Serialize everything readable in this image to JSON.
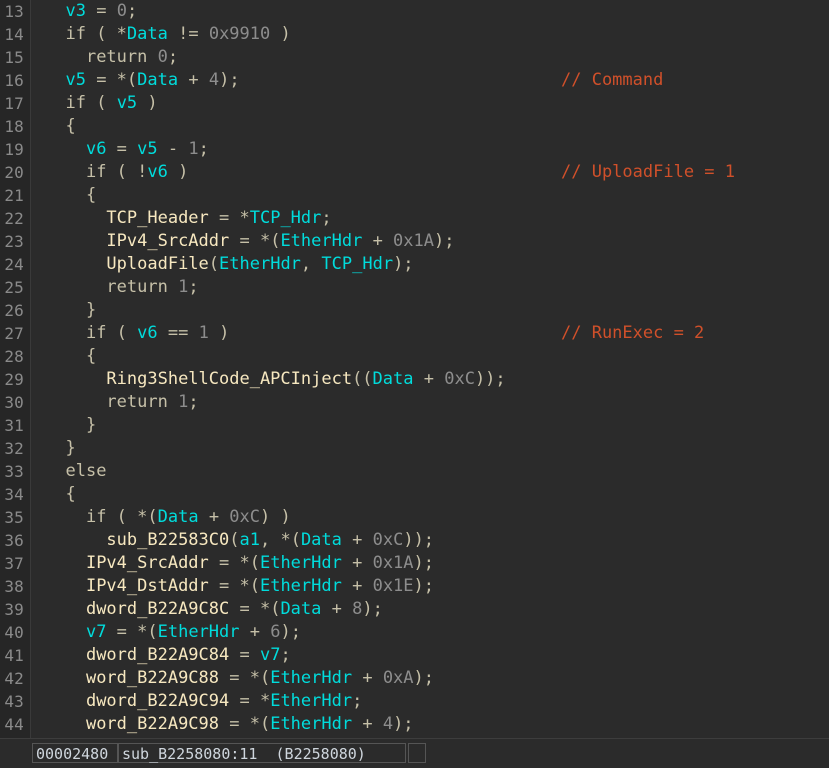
{
  "app": {
    "name": "IDA Pro",
    "view": "Pseudocode decompiler view"
  },
  "theme": {
    "background": "#2b2b2b",
    "gutter_background": "#262626",
    "keyword": "#c6c0a8",
    "punctuation": "#c6c0a8",
    "local_variable": "#00dcdc",
    "global_symbol": "#f7e8c0",
    "number": "#8d8d8d",
    "comment": "#d0502a",
    "line_number": "#8a8a8a",
    "status_text": "#cfd6dd"
  },
  "editor": {
    "first_line_number": 13,
    "last_line_number": 44,
    "lines": [
      {
        "n": "13",
        "tokens": [
          {
            "t": "  ",
            "c": "punct"
          },
          {
            "t": "v3",
            "c": "local"
          },
          {
            "t": " = ",
            "c": "punct"
          },
          {
            "t": "0",
            "c": "num"
          },
          {
            "t": ";",
            "c": "punct"
          }
        ],
        "comment": ""
      },
      {
        "n": "14",
        "tokens": [
          {
            "t": "  ",
            "c": "punct"
          },
          {
            "t": "if",
            "c": "kw"
          },
          {
            "t": " ( *",
            "c": "punct"
          },
          {
            "t": "Data",
            "c": "local"
          },
          {
            "t": " != ",
            "c": "punct"
          },
          {
            "t": "0x9910",
            "c": "num"
          },
          {
            "t": " )",
            "c": "punct"
          }
        ],
        "comment": ""
      },
      {
        "n": "15",
        "tokens": [
          {
            "t": "    ",
            "c": "punct"
          },
          {
            "t": "return",
            "c": "kw"
          },
          {
            "t": " ",
            "c": "punct"
          },
          {
            "t": "0",
            "c": "num"
          },
          {
            "t": ";",
            "c": "punct"
          }
        ],
        "comment": ""
      },
      {
        "n": "16",
        "tokens": [
          {
            "t": "  ",
            "c": "punct"
          },
          {
            "t": "v5",
            "c": "local"
          },
          {
            "t": " = *(",
            "c": "punct"
          },
          {
            "t": "Data",
            "c": "local"
          },
          {
            "t": " + ",
            "c": "punct"
          },
          {
            "t": "4",
            "c": "num"
          },
          {
            "t": ");",
            "c": "punct"
          }
        ],
        "comment": "// Command"
      },
      {
        "n": "17",
        "tokens": [
          {
            "t": "  ",
            "c": "punct"
          },
          {
            "t": "if",
            "c": "kw"
          },
          {
            "t": " ( ",
            "c": "punct"
          },
          {
            "t": "v5",
            "c": "local"
          },
          {
            "t": " )",
            "c": "punct"
          }
        ],
        "comment": ""
      },
      {
        "n": "18",
        "tokens": [
          {
            "t": "  {",
            "c": "punct"
          }
        ],
        "comment": ""
      },
      {
        "n": "19",
        "tokens": [
          {
            "t": "    ",
            "c": "punct"
          },
          {
            "t": "v6",
            "c": "local"
          },
          {
            "t": " = ",
            "c": "punct"
          },
          {
            "t": "v5",
            "c": "local"
          },
          {
            "t": " - ",
            "c": "punct"
          },
          {
            "t": "1",
            "c": "num"
          },
          {
            "t": ";",
            "c": "punct"
          }
        ],
        "comment": ""
      },
      {
        "n": "20",
        "tokens": [
          {
            "t": "    ",
            "c": "punct"
          },
          {
            "t": "if",
            "c": "kw"
          },
          {
            "t": " ( !",
            "c": "punct"
          },
          {
            "t": "v6",
            "c": "local"
          },
          {
            "t": " )",
            "c": "punct"
          }
        ],
        "comment": "// UploadFile = 1"
      },
      {
        "n": "21",
        "tokens": [
          {
            "t": "    {",
            "c": "punct"
          }
        ],
        "comment": ""
      },
      {
        "n": "22",
        "tokens": [
          {
            "t": "      ",
            "c": "punct"
          },
          {
            "t": "TCP_Header",
            "c": "glob"
          },
          {
            "t": " = *",
            "c": "punct"
          },
          {
            "t": "TCP_Hdr",
            "c": "local"
          },
          {
            "t": ";",
            "c": "punct"
          }
        ],
        "comment": ""
      },
      {
        "n": "23",
        "tokens": [
          {
            "t": "      ",
            "c": "punct"
          },
          {
            "t": "IPv4_SrcAddr",
            "c": "glob"
          },
          {
            "t": " = *(",
            "c": "punct"
          },
          {
            "t": "EtherHdr",
            "c": "local"
          },
          {
            "t": " + ",
            "c": "punct"
          },
          {
            "t": "0x1A",
            "c": "num"
          },
          {
            "t": ");",
            "c": "punct"
          }
        ],
        "comment": ""
      },
      {
        "n": "24",
        "tokens": [
          {
            "t": "      ",
            "c": "punct"
          },
          {
            "t": "UploadFile",
            "c": "glob"
          },
          {
            "t": "(",
            "c": "punct"
          },
          {
            "t": "EtherHdr",
            "c": "local"
          },
          {
            "t": ", ",
            "c": "punct"
          },
          {
            "t": "TCP_Hdr",
            "c": "local"
          },
          {
            "t": ");",
            "c": "punct"
          }
        ],
        "comment": ""
      },
      {
        "n": "25",
        "tokens": [
          {
            "t": "      ",
            "c": "punct"
          },
          {
            "t": "return",
            "c": "kw"
          },
          {
            "t": " ",
            "c": "punct"
          },
          {
            "t": "1",
            "c": "num"
          },
          {
            "t": ";",
            "c": "punct"
          }
        ],
        "comment": ""
      },
      {
        "n": "26",
        "tokens": [
          {
            "t": "    }",
            "c": "punct"
          }
        ],
        "comment": ""
      },
      {
        "n": "27",
        "tokens": [
          {
            "t": "    ",
            "c": "punct"
          },
          {
            "t": "if",
            "c": "kw"
          },
          {
            "t": " ( ",
            "c": "punct"
          },
          {
            "t": "v6",
            "c": "local"
          },
          {
            "t": " == ",
            "c": "punct"
          },
          {
            "t": "1",
            "c": "num"
          },
          {
            "t": " )",
            "c": "punct"
          }
        ],
        "comment": "// RunExec = 2"
      },
      {
        "n": "28",
        "tokens": [
          {
            "t": "    {",
            "c": "punct"
          }
        ],
        "comment": ""
      },
      {
        "n": "29",
        "tokens": [
          {
            "t": "      ",
            "c": "punct"
          },
          {
            "t": "Ring3ShellCode_APCInject",
            "c": "glob"
          },
          {
            "t": "((",
            "c": "punct"
          },
          {
            "t": "Data",
            "c": "local"
          },
          {
            "t": " + ",
            "c": "punct"
          },
          {
            "t": "0xC",
            "c": "num"
          },
          {
            "t": "));",
            "c": "punct"
          }
        ],
        "comment": ""
      },
      {
        "n": "30",
        "tokens": [
          {
            "t": "      ",
            "c": "punct"
          },
          {
            "t": "return",
            "c": "kw"
          },
          {
            "t": " ",
            "c": "punct"
          },
          {
            "t": "1",
            "c": "num"
          },
          {
            "t": ";",
            "c": "punct"
          }
        ],
        "comment": ""
      },
      {
        "n": "31",
        "tokens": [
          {
            "t": "    }",
            "c": "punct"
          }
        ],
        "comment": ""
      },
      {
        "n": "32",
        "tokens": [
          {
            "t": "  }",
            "c": "punct"
          }
        ],
        "comment": ""
      },
      {
        "n": "33",
        "tokens": [
          {
            "t": "  ",
            "c": "punct"
          },
          {
            "t": "else",
            "c": "kw"
          }
        ],
        "comment": ""
      },
      {
        "n": "34",
        "tokens": [
          {
            "t": "  {",
            "c": "punct"
          }
        ],
        "comment": ""
      },
      {
        "n": "35",
        "tokens": [
          {
            "t": "    ",
            "c": "punct"
          },
          {
            "t": "if",
            "c": "kw"
          },
          {
            "t": " ( *(",
            "c": "punct"
          },
          {
            "t": "Data",
            "c": "local"
          },
          {
            "t": " + ",
            "c": "punct"
          },
          {
            "t": "0xC",
            "c": "num"
          },
          {
            "t": ") )",
            "c": "punct"
          }
        ],
        "comment": ""
      },
      {
        "n": "36",
        "tokens": [
          {
            "t": "      ",
            "c": "punct"
          },
          {
            "t": "sub_B22583C0",
            "c": "glob"
          },
          {
            "t": "(",
            "c": "punct"
          },
          {
            "t": "a1",
            "c": "local"
          },
          {
            "t": ", *(",
            "c": "punct"
          },
          {
            "t": "Data",
            "c": "local"
          },
          {
            "t": " + ",
            "c": "punct"
          },
          {
            "t": "0xC",
            "c": "num"
          },
          {
            "t": "));",
            "c": "punct"
          }
        ],
        "comment": ""
      },
      {
        "n": "37",
        "tokens": [
          {
            "t": "    ",
            "c": "punct"
          },
          {
            "t": "IPv4_SrcAddr",
            "c": "glob"
          },
          {
            "t": " = *(",
            "c": "punct"
          },
          {
            "t": "EtherHdr",
            "c": "local"
          },
          {
            "t": " + ",
            "c": "punct"
          },
          {
            "t": "0x1A",
            "c": "num"
          },
          {
            "t": ");",
            "c": "punct"
          }
        ],
        "comment": ""
      },
      {
        "n": "38",
        "tokens": [
          {
            "t": "    ",
            "c": "punct"
          },
          {
            "t": "IPv4_DstAddr",
            "c": "glob"
          },
          {
            "t": " = *(",
            "c": "punct"
          },
          {
            "t": "EtherHdr",
            "c": "local"
          },
          {
            "t": " + ",
            "c": "punct"
          },
          {
            "t": "0x1E",
            "c": "num"
          },
          {
            "t": ");",
            "c": "punct"
          }
        ],
        "comment": ""
      },
      {
        "n": "39",
        "tokens": [
          {
            "t": "    ",
            "c": "punct"
          },
          {
            "t": "dword_B22A9C8C",
            "c": "glob"
          },
          {
            "t": " = *(",
            "c": "punct"
          },
          {
            "t": "Data",
            "c": "local"
          },
          {
            "t": " + ",
            "c": "punct"
          },
          {
            "t": "8",
            "c": "num"
          },
          {
            "t": ");",
            "c": "punct"
          }
        ],
        "comment": ""
      },
      {
        "n": "40",
        "tokens": [
          {
            "t": "    ",
            "c": "punct"
          },
          {
            "t": "v7",
            "c": "local"
          },
          {
            "t": " = *(",
            "c": "punct"
          },
          {
            "t": "EtherHdr",
            "c": "local"
          },
          {
            "t": " + ",
            "c": "punct"
          },
          {
            "t": "6",
            "c": "num"
          },
          {
            "t": ");",
            "c": "punct"
          }
        ],
        "comment": ""
      },
      {
        "n": "41",
        "tokens": [
          {
            "t": "    ",
            "c": "punct"
          },
          {
            "t": "dword_B22A9C84",
            "c": "glob"
          },
          {
            "t": " = ",
            "c": "punct"
          },
          {
            "t": "v7",
            "c": "local"
          },
          {
            "t": ";",
            "c": "punct"
          }
        ],
        "comment": ""
      },
      {
        "n": "42",
        "tokens": [
          {
            "t": "    ",
            "c": "punct"
          },
          {
            "t": "word_B22A9C88",
            "c": "glob"
          },
          {
            "t": " = *(",
            "c": "punct"
          },
          {
            "t": "EtherHdr",
            "c": "local"
          },
          {
            "t": " + ",
            "c": "punct"
          },
          {
            "t": "0xA",
            "c": "num"
          },
          {
            "t": ");",
            "c": "punct"
          }
        ],
        "comment": ""
      },
      {
        "n": "43",
        "tokens": [
          {
            "t": "    ",
            "c": "punct"
          },
          {
            "t": "dword_B22A9C94",
            "c": "glob"
          },
          {
            "t": " = *",
            "c": "punct"
          },
          {
            "t": "EtherHdr",
            "c": "local"
          },
          {
            "t": ";",
            "c": "punct"
          }
        ],
        "comment": ""
      },
      {
        "n": "44",
        "tokens": [
          {
            "t": "    ",
            "c": "punct"
          },
          {
            "t": "word_B22A9C98",
            "c": "glob"
          },
          {
            "t": " = *(",
            "c": "punct"
          },
          {
            "t": "EtherHdr",
            "c": "local"
          },
          {
            "t": " + ",
            "c": "punct"
          },
          {
            "t": "4",
            "c": "num"
          },
          {
            "t": ");",
            "c": "punct"
          }
        ],
        "comment": ""
      }
    ]
  },
  "status_bar": {
    "address": "00002480",
    "location": "sub_B2258080:11  (B2258080)",
    "extra": ""
  }
}
